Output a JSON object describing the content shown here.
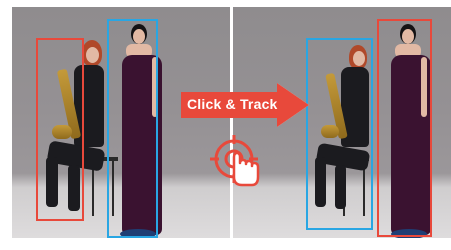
{
  "overlay": {
    "label": "Click & Track"
  },
  "colors": {
    "accent": "#e8493b",
    "box_blue": "#29a6e3",
    "box_red": "#e8493b"
  },
  "icons": {
    "click": "click-target-hand-icon",
    "arrow": "arrow-right"
  }
}
